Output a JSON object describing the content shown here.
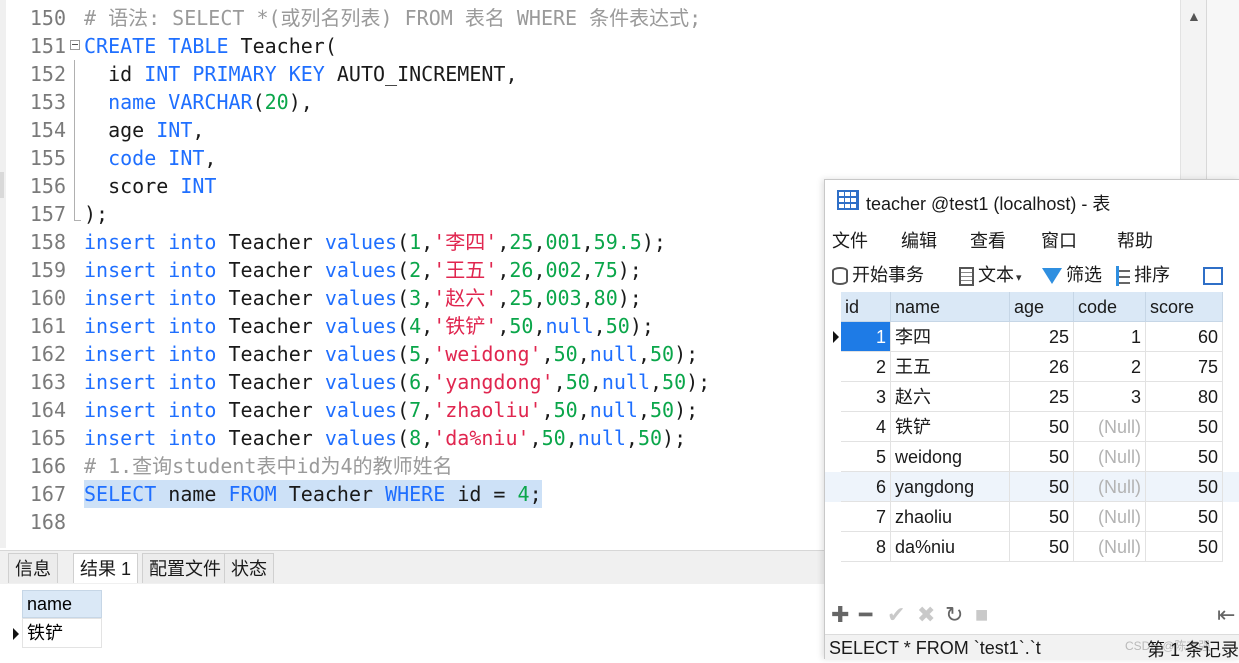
{
  "editor": {
    "lines": [
      {
        "no": "150",
        "tokens": [
          {
            "t": "# 语法: SELECT *(或列名列表) FROM 表名 WHERE 条件表达式;",
            "c": "cmt"
          }
        ]
      },
      {
        "no": "151",
        "fold": "open",
        "tokens": [
          {
            "t": "CREATE TABLE ",
            "c": "kw"
          },
          {
            "t": "Teacher(",
            "c": "plain"
          }
        ]
      },
      {
        "no": "152",
        "fold": "line",
        "tokens": [
          {
            "t": "  id ",
            "c": "plain"
          },
          {
            "t": "INT PRIMARY KEY ",
            "c": "kw"
          },
          {
            "t": "AUTO_INCREMENT,",
            "c": "plain"
          }
        ]
      },
      {
        "no": "153",
        "fold": "line",
        "tokens": [
          {
            "t": "  ",
            "c": "plain"
          },
          {
            "t": "name VARCHAR",
            "c": "kw"
          },
          {
            "t": "(",
            "c": "plain"
          },
          {
            "t": "20",
            "c": "num"
          },
          {
            "t": "),",
            "c": "plain"
          }
        ]
      },
      {
        "no": "154",
        "fold": "line",
        "tokens": [
          {
            "t": "  age ",
            "c": "plain"
          },
          {
            "t": "INT",
            "c": "kw"
          },
          {
            "t": ",",
            "c": "plain"
          }
        ]
      },
      {
        "no": "155",
        "fold": "line",
        "tokens": [
          {
            "t": "  ",
            "c": "plain"
          },
          {
            "t": "code INT",
            "c": "kw"
          },
          {
            "t": ",",
            "c": "plain"
          }
        ]
      },
      {
        "no": "156",
        "fold": "line",
        "tokens": [
          {
            "t": "  score ",
            "c": "plain"
          },
          {
            "t": "INT",
            "c": "kw"
          }
        ]
      },
      {
        "no": "157",
        "fold": "end",
        "tokens": [
          {
            "t": ");",
            "c": "plain"
          }
        ]
      },
      {
        "no": "158",
        "tokens": [
          {
            "t": "insert into ",
            "c": "kw"
          },
          {
            "t": "Teacher ",
            "c": "plain"
          },
          {
            "t": "values",
            "c": "kw"
          },
          {
            "t": "(",
            "c": "plain"
          },
          {
            "t": "1",
            "c": "num"
          },
          {
            "t": ",",
            "c": "plain"
          },
          {
            "t": "'李四'",
            "c": "str"
          },
          {
            "t": ",",
            "c": "plain"
          },
          {
            "t": "25",
            "c": "num"
          },
          {
            "t": ",",
            "c": "plain"
          },
          {
            "t": "001",
            "c": "num"
          },
          {
            "t": ",",
            "c": "plain"
          },
          {
            "t": "59.5",
            "c": "num"
          },
          {
            "t": ");",
            "c": "plain"
          }
        ]
      },
      {
        "no": "159",
        "tokens": [
          {
            "t": "insert into ",
            "c": "kw"
          },
          {
            "t": "Teacher ",
            "c": "plain"
          },
          {
            "t": "values",
            "c": "kw"
          },
          {
            "t": "(",
            "c": "plain"
          },
          {
            "t": "2",
            "c": "num"
          },
          {
            "t": ",",
            "c": "plain"
          },
          {
            "t": "'王五'",
            "c": "str"
          },
          {
            "t": ",",
            "c": "plain"
          },
          {
            "t": "26",
            "c": "num"
          },
          {
            "t": ",",
            "c": "plain"
          },
          {
            "t": "002",
            "c": "num"
          },
          {
            "t": ",",
            "c": "plain"
          },
          {
            "t": "75",
            "c": "num"
          },
          {
            "t": ");",
            "c": "plain"
          }
        ]
      },
      {
        "no": "160",
        "tokens": [
          {
            "t": "insert into ",
            "c": "kw"
          },
          {
            "t": "Teacher ",
            "c": "plain"
          },
          {
            "t": "values",
            "c": "kw"
          },
          {
            "t": "(",
            "c": "plain"
          },
          {
            "t": "3",
            "c": "num"
          },
          {
            "t": ",",
            "c": "plain"
          },
          {
            "t": "'赵六'",
            "c": "str"
          },
          {
            "t": ",",
            "c": "plain"
          },
          {
            "t": "25",
            "c": "num"
          },
          {
            "t": ",",
            "c": "plain"
          },
          {
            "t": "003",
            "c": "num"
          },
          {
            "t": ",",
            "c": "plain"
          },
          {
            "t": "80",
            "c": "num"
          },
          {
            "t": ");",
            "c": "plain"
          }
        ]
      },
      {
        "no": "161",
        "tokens": [
          {
            "t": "insert into ",
            "c": "kw"
          },
          {
            "t": "Teacher ",
            "c": "plain"
          },
          {
            "t": "values",
            "c": "kw"
          },
          {
            "t": "(",
            "c": "plain"
          },
          {
            "t": "4",
            "c": "num"
          },
          {
            "t": ",",
            "c": "plain"
          },
          {
            "t": "'铁铲'",
            "c": "str"
          },
          {
            "t": ",",
            "c": "plain"
          },
          {
            "t": "50",
            "c": "num"
          },
          {
            "t": ",",
            "c": "plain"
          },
          {
            "t": "null",
            "c": "kw"
          },
          {
            "t": ",",
            "c": "plain"
          },
          {
            "t": "50",
            "c": "num"
          },
          {
            "t": ");",
            "c": "plain"
          }
        ]
      },
      {
        "no": "162",
        "tokens": [
          {
            "t": "insert into ",
            "c": "kw"
          },
          {
            "t": "Teacher ",
            "c": "plain"
          },
          {
            "t": "values",
            "c": "kw"
          },
          {
            "t": "(",
            "c": "plain"
          },
          {
            "t": "5",
            "c": "num"
          },
          {
            "t": ",",
            "c": "plain"
          },
          {
            "t": "'weidong'",
            "c": "str"
          },
          {
            "t": ",",
            "c": "plain"
          },
          {
            "t": "50",
            "c": "num"
          },
          {
            "t": ",",
            "c": "plain"
          },
          {
            "t": "null",
            "c": "kw"
          },
          {
            "t": ",",
            "c": "plain"
          },
          {
            "t": "50",
            "c": "num"
          },
          {
            "t": ");",
            "c": "plain"
          }
        ]
      },
      {
        "no": "163",
        "tokens": [
          {
            "t": "insert into ",
            "c": "kw"
          },
          {
            "t": "Teacher ",
            "c": "plain"
          },
          {
            "t": "values",
            "c": "kw"
          },
          {
            "t": "(",
            "c": "plain"
          },
          {
            "t": "6",
            "c": "num"
          },
          {
            "t": ",",
            "c": "plain"
          },
          {
            "t": "'yangdong'",
            "c": "str"
          },
          {
            "t": ",",
            "c": "plain"
          },
          {
            "t": "50",
            "c": "num"
          },
          {
            "t": ",",
            "c": "plain"
          },
          {
            "t": "null",
            "c": "kw"
          },
          {
            "t": ",",
            "c": "plain"
          },
          {
            "t": "50",
            "c": "num"
          },
          {
            "t": ");",
            "c": "plain"
          }
        ]
      },
      {
        "no": "164",
        "tokens": [
          {
            "t": "insert into ",
            "c": "kw"
          },
          {
            "t": "Teacher ",
            "c": "plain"
          },
          {
            "t": "values",
            "c": "kw"
          },
          {
            "t": "(",
            "c": "plain"
          },
          {
            "t": "7",
            "c": "num"
          },
          {
            "t": ",",
            "c": "plain"
          },
          {
            "t": "'zhaoliu'",
            "c": "str"
          },
          {
            "t": ",",
            "c": "plain"
          },
          {
            "t": "50",
            "c": "num"
          },
          {
            "t": ",",
            "c": "plain"
          },
          {
            "t": "null",
            "c": "kw"
          },
          {
            "t": ",",
            "c": "plain"
          },
          {
            "t": "50",
            "c": "num"
          },
          {
            "t": ");",
            "c": "plain"
          }
        ]
      },
      {
        "no": "165",
        "tokens": [
          {
            "t": "insert into ",
            "c": "kw"
          },
          {
            "t": "Teacher ",
            "c": "plain"
          },
          {
            "t": "values",
            "c": "kw"
          },
          {
            "t": "(",
            "c": "plain"
          },
          {
            "t": "8",
            "c": "num"
          },
          {
            "t": ",",
            "c": "plain"
          },
          {
            "t": "'da%niu'",
            "c": "str"
          },
          {
            "t": ",",
            "c": "plain"
          },
          {
            "t": "50",
            "c": "num"
          },
          {
            "t": ",",
            "c": "plain"
          },
          {
            "t": "null",
            "c": "kw"
          },
          {
            "t": ",",
            "c": "plain"
          },
          {
            "t": "50",
            "c": "num"
          },
          {
            "t": ");",
            "c": "plain"
          }
        ]
      },
      {
        "no": "166",
        "tokens": [
          {
            "t": "# 1.查询student表中id为4的教师姓名",
            "c": "cmt"
          }
        ]
      },
      {
        "no": "167",
        "selected": true,
        "tokens": [
          {
            "t": "SELECT ",
            "c": "kw"
          },
          {
            "t": "name ",
            "c": "plain"
          },
          {
            "t": "FROM ",
            "c": "kw"
          },
          {
            "t": "Teacher ",
            "c": "plain"
          },
          {
            "t": "WHERE ",
            "c": "kw"
          },
          {
            "t": "id = ",
            "c": "plain"
          },
          {
            "t": "4",
            "c": "num"
          },
          {
            "t": ";",
            "c": "plain"
          }
        ]
      },
      {
        "no": "168",
        "tokens": []
      }
    ]
  },
  "result_tabs": [
    "信息",
    "结果 1",
    "配置文件",
    "状态"
  ],
  "result": {
    "column": "name",
    "row_value": "铁铲"
  },
  "table_window": {
    "title": "teacher @test1 (localhost) - 表",
    "menu": [
      "文件",
      "编辑",
      "查看",
      "窗口",
      "帮助"
    ],
    "toolbar": {
      "begin_tx": "开始事务",
      "text": "文本",
      "filter": "筛选",
      "sort": "排序"
    },
    "columns": [
      "id",
      "name",
      "age",
      "code",
      "score"
    ],
    "rows": [
      {
        "id": "1",
        "name": "李四",
        "age": "25",
        "code": "1",
        "score": "60"
      },
      {
        "id": "2",
        "name": "王五",
        "age": "26",
        "code": "2",
        "score": "75"
      },
      {
        "id": "3",
        "name": "赵六",
        "age": "25",
        "code": "3",
        "score": "80"
      },
      {
        "id": "4",
        "name": "铁铲",
        "age": "50",
        "code": "(Null)",
        "score": "50"
      },
      {
        "id": "5",
        "name": "weidong",
        "age": "50",
        "code": "(Null)",
        "score": "50"
      },
      {
        "id": "6",
        "name": "yangdong",
        "age": "50",
        "code": "(Null)",
        "score": "50"
      },
      {
        "id": "7",
        "name": "zhaoliu",
        "age": "50",
        "code": "(Null)",
        "score": "50"
      },
      {
        "id": "8",
        "name": "da%niu",
        "age": "50",
        "code": "(Null)",
        "score": "50"
      }
    ],
    "nav_icons": [
      "add-icon",
      "remove-icon",
      "check-icon",
      "cancel-icon",
      "refresh-icon",
      "stop-icon",
      "first-page-icon"
    ],
    "sql_status": "SELECT * FROM `test1`.`t",
    "record_status": "第 1 条记录",
    "watermark": "CSDN @陈志强"
  },
  "colors": {
    "keyword": "#1f6fff",
    "number": "#0aa64a",
    "string": "#e0264f",
    "comment": "#9a9a9a",
    "selection": "#cde1f7",
    "header": "#dae8f6",
    "selected_cell": "#1e7be6"
  }
}
